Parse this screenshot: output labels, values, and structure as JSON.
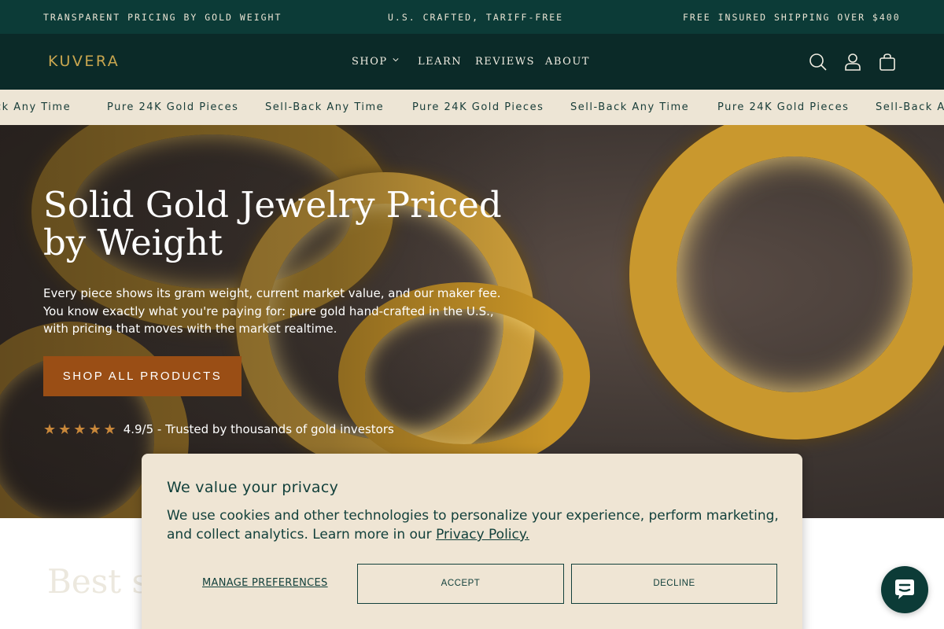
{
  "announcement": {
    "left": "TRANSPARENT PRICING BY GOLD WEIGHT",
    "center": "U.S. CRAFTED, TARIFF-FREE",
    "right": "FREE INSURED SHIPPING OVER $400"
  },
  "header": {
    "logo": "KUVERA",
    "nav": [
      "SHOP",
      "LEARN",
      "REVIEWS",
      "ABOUT"
    ],
    "icons": [
      "search-icon",
      "account-icon",
      "cart-icon"
    ]
  },
  "marquee": {
    "items": [
      "ck Any Time",
      "Pure 24K Gold Pieces",
      "Sell-Back Any Time",
      "Pure 24K Gold Pieces",
      "Sell-Back Any Time",
      "Pure 24K Gold Pieces",
      "Sell-Back An"
    ]
  },
  "hero": {
    "title": "Solid Gold Jewelry Priced by Weight",
    "description": "Every piece shows its gram weight, current market value, and our maker fee. You know exactly what you're paying for: pure gold hand-crafted in the U.S., with pricing that moves with the market realtime.",
    "cta": "SHOP ALL PRODUCTS",
    "stars": "★★★★★",
    "rating_text": "4.9/5 - Trusted by thousands of gold investors"
  },
  "section": {
    "title": "Best se"
  },
  "cookie": {
    "title": "We value your privacy",
    "text": "We use cookies and other technologies to personalize your experience, perform marketing, and collect analytics. Learn more in our ",
    "link": "Privacy Policy.",
    "manage": "MANAGE PREFERENCES",
    "accept": "ACCEPT",
    "decline": "DECLINE"
  },
  "chat": {
    "icon": "chat-bubble-icon"
  },
  "colors": {
    "announcement_bg": "#0c3b37",
    "header_bg": "#0b2a28",
    "logo_gold": "#c9a64f",
    "marquee_bg": "#ede5d5",
    "cta_bg": "#9a4e15",
    "star_color": "#c8873a",
    "cookie_bg": "#efe5d4"
  }
}
